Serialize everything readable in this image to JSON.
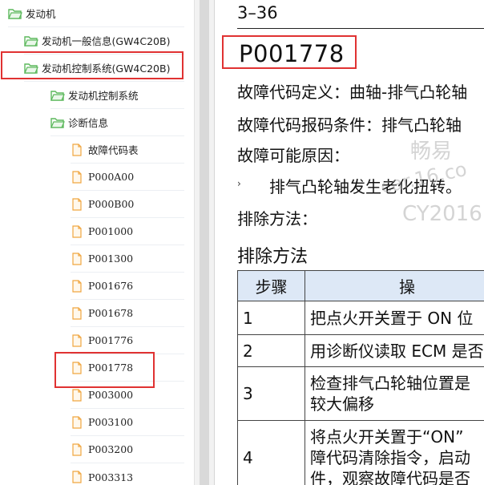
{
  "tree": {
    "items": [
      {
        "label": "发动机",
        "type": "folder"
      },
      {
        "label": "发动机一般信息(GW4C20B)",
        "type": "folder"
      },
      {
        "label": "发动机控制系统(GW4C20B)",
        "type": "folder"
      },
      {
        "label": "发动机控制系统",
        "type": "folder"
      },
      {
        "label": "诊断信息",
        "type": "folder"
      },
      {
        "label": "故障代码表",
        "type": "file"
      },
      {
        "label": "P000A00",
        "type": "file"
      },
      {
        "label": "P000B00",
        "type": "file"
      },
      {
        "label": "P001000",
        "type": "file"
      },
      {
        "label": "P001300",
        "type": "file"
      },
      {
        "label": "P001676",
        "type": "file"
      },
      {
        "label": "P001678",
        "type": "file"
      },
      {
        "label": "P001776",
        "type": "file"
      },
      {
        "label": "P001778",
        "type": "file"
      },
      {
        "label": "P003000",
        "type": "file"
      },
      {
        "label": "P003100",
        "type": "file"
      },
      {
        "label": "P003200",
        "type": "file"
      },
      {
        "label": "P003313",
        "type": "file"
      }
    ],
    "selected": "P001778"
  },
  "doc": {
    "page_number": "3–36",
    "code": "P001778",
    "definition": "故障代码定义：曲轴-排气凸轮轴",
    "condition": "故障代码报码条件：排气凸轮轴",
    "causes_heading": "故障可能原因：",
    "bullet_symbol": "›",
    "cause_1": "排气凸轮轴发生老化扭转。",
    "remedy_label": "排除方法：",
    "remedy_heading": "排除方法",
    "table": {
      "headers": [
        "步骤",
        "操"
      ],
      "rows": [
        {
          "step": "1",
          "lines": [
            "把点火开关置于 ON 位"
          ]
        },
        {
          "step": "2",
          "lines": [
            "用诊断仪读取 ECM 是否"
          ]
        },
        {
          "step": "3",
          "lines": [
            "检查排气凸轮轴位置是",
            "较大偏移"
          ]
        },
        {
          "step": "4",
          "lines": [
            "将点火开关置于“ON”",
            "障代码清除指令，启动",
            "件，观察故障代码是否"
          ]
        }
      ]
    }
  },
  "watermark": {
    "line1": "畅易",
    "line2": "car.16.co",
    "line3": "CY2016"
  },
  "colors": {
    "highlight": "#e03232",
    "folder": "#5cb85c",
    "file": "#f0a640",
    "table_header": "#dde8f6"
  }
}
